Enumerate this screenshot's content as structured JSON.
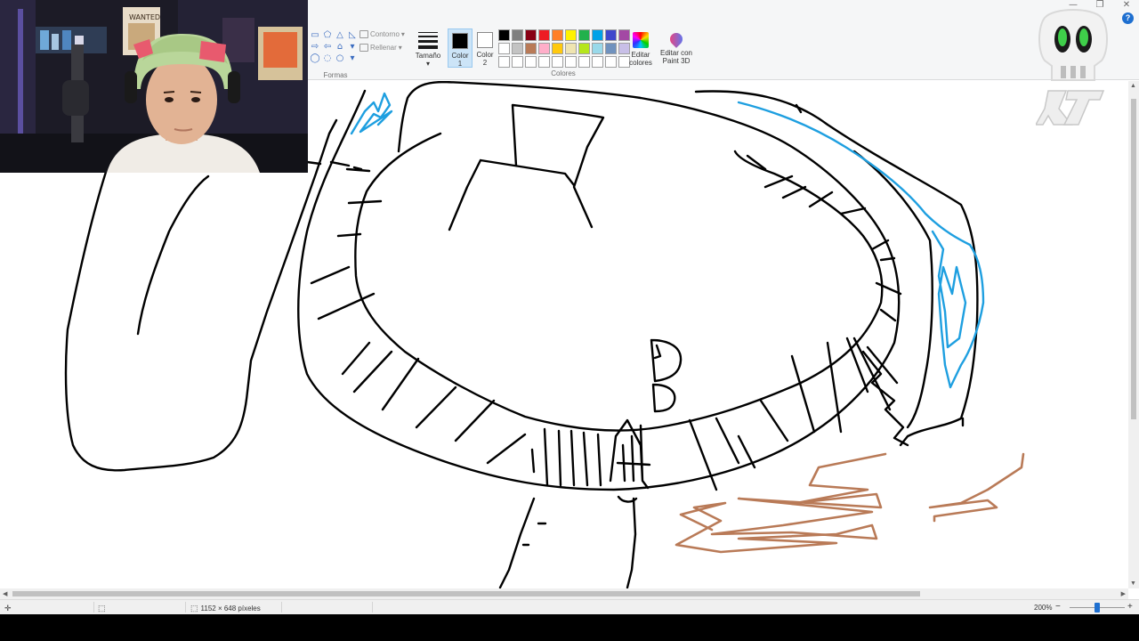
{
  "ribbon": {
    "shapes": {
      "outline_label": "Contorno",
      "fill_label": "Rellenar",
      "group_label": "Formas"
    },
    "size_label": "Tamaño",
    "color1_label": [
      "Color",
      "1"
    ],
    "color2_label": [
      "Color",
      "2"
    ],
    "colors_group_label": "Colores",
    "edit_colors_label": [
      "Editar",
      "colores"
    ],
    "edit_paint3d_label": [
      "Editar con",
      "Paint 3D"
    ],
    "color1_value": "#000000",
    "color2_value": "#ffffff",
    "palette": [
      "#000000",
      "#7f7f7f",
      "#880015",
      "#ed1c24",
      "#ff7f27",
      "#fff200",
      "#22b14c",
      "#00a2e8",
      "#3f48cc",
      "#a349a4",
      "#ffffff",
      "#c3c3c3",
      "#b97a57",
      "#ffaec9",
      "#ffc90e",
      "#efe4b0",
      "#b5e61d",
      "#99d9ea",
      "#7092be",
      "#c8bfe7",
      "#ffffff",
      "#ffffff",
      "#ffffff",
      "#ffffff",
      "#ffffff",
      "#ffffff",
      "#ffffff",
      "#ffffff",
      "#ffffff",
      "#ffffff"
    ]
  },
  "window_controls": [
    "—",
    "❐",
    "✕"
  ],
  "help_label": "?",
  "statusbar": {
    "dimensions": "1152 × 648 píxeles",
    "zoom": "200%",
    "zoom_fraction": 0.5,
    "zoom_out": "−",
    "zoom_in": "+"
  },
  "overlay": {
    "poster_text": "WANTED"
  },
  "colors": {
    "ink": "#000000",
    "blue": "#1e9fe0",
    "brown": "#b97a57",
    "accent": "#1e6fd0"
  }
}
